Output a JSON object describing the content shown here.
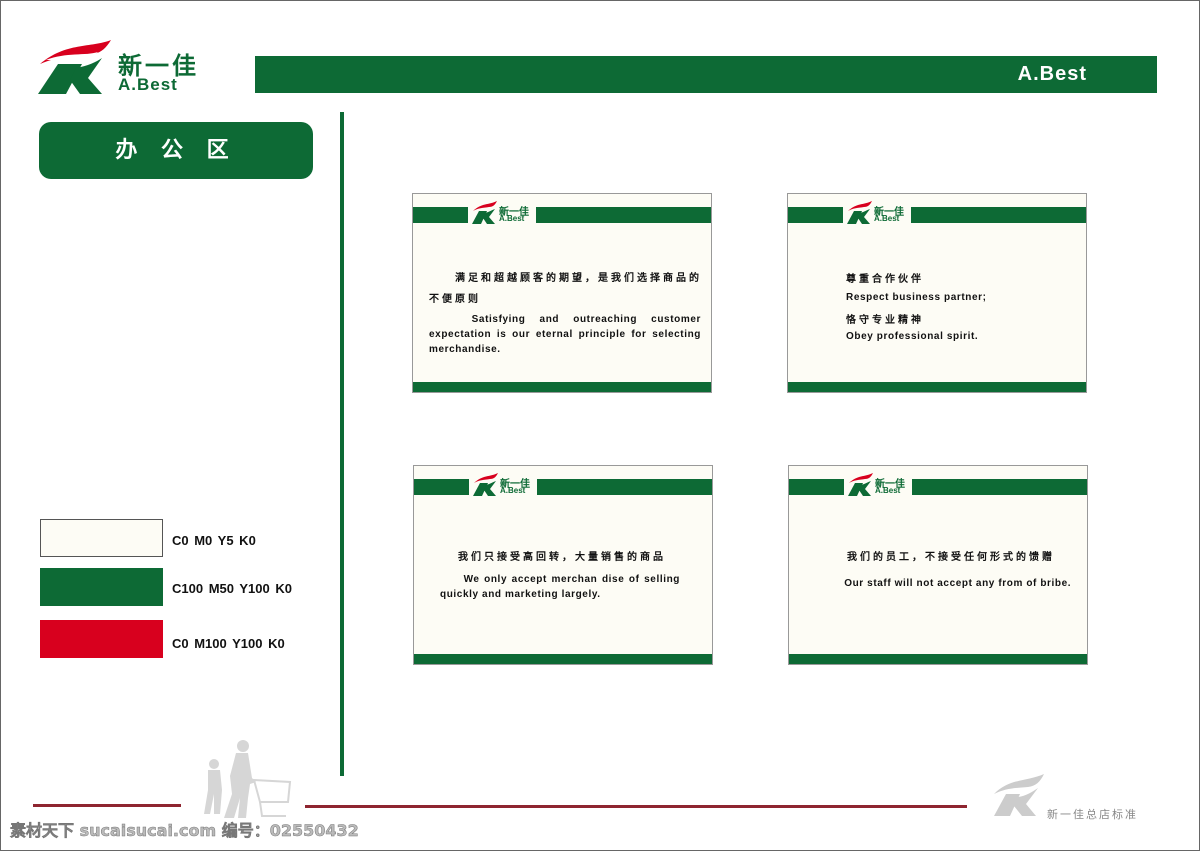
{
  "brand": {
    "name_cn": "新一佳",
    "name_en": "A.Best",
    "colors": {
      "green": "#0d6a35",
      "red": "#d8001e",
      "cream": "#fdfcf5"
    }
  },
  "header": {
    "bar_label": "A.Best"
  },
  "area_title": "办 公 区",
  "swatches": [
    {
      "label": "C0   M0   Y5   K0",
      "color": "#fdfcf5"
    },
    {
      "label": "C100 M50 Y100 K0",
      "color": "#0d6a35"
    },
    {
      "label": "C0 M100 Y100 K0",
      "color": "#d8001e"
    }
  ],
  "cards": [
    {
      "lines": [
        {
          "type": "cn",
          "text": "　　满足和超越顾客的期望，是我们选择商品的不便原则"
        },
        {
          "type": "en",
          "text": "　　Satisfying and outreaching customer expectation is our eternal principle for selecting merchandise."
        }
      ]
    },
    {
      "lines": [
        {
          "type": "cn",
          "text": "尊重合作伙伴"
        },
        {
          "type": "en",
          "text": "Respect business partner;"
        },
        {
          "type": "cn",
          "text": "恪守专业精神"
        },
        {
          "type": "en",
          "text": "Obey professional spirit."
        }
      ]
    },
    {
      "lines": [
        {
          "type": "cn",
          "text": "我们只接受高回转，大量销售的商品"
        },
        {
          "type": "en",
          "text": "　　We only accept merchan dise of selling quickly and marketing largely."
        }
      ]
    },
    {
      "lines": [
        {
          "type": "cn",
          "text": "我们的员工，不接受任何形式的馈赠"
        },
        {
          "type": "en",
          "text": "　　Our staff will not accept any from of bribe."
        }
      ]
    }
  ],
  "footer": {
    "standard_label": "新一佳总店标准",
    "watermark": "素材天下 sucaisucai.com  编号：02550432"
  }
}
